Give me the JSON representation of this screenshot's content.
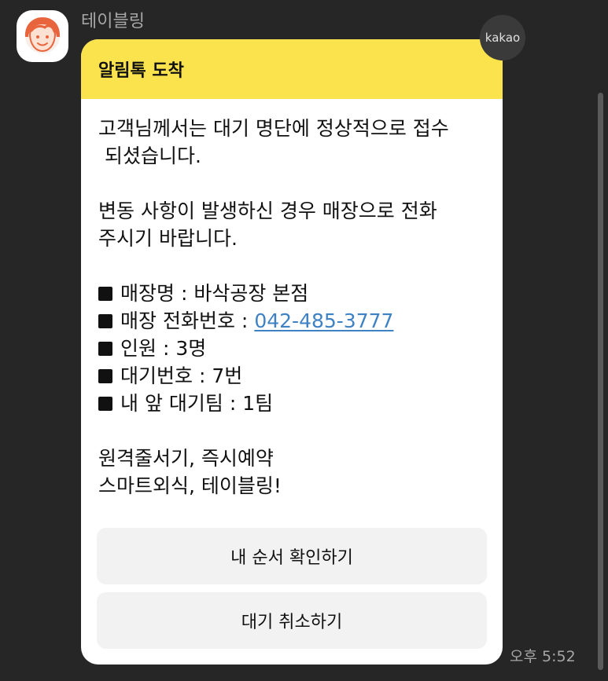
{
  "sender": {
    "name": "테이블링"
  },
  "badge": {
    "label": "kakao"
  },
  "message": {
    "header_title": "알림톡 도착",
    "paragraph1_line1": "고객님께서는 대기 명단에 정상적으로 접수",
    "paragraph1_line2": " 되셨습니다.",
    "paragraph2_line1": "변동 사항이 발생하신 경우 매장으로 전화",
    "paragraph2_line2": "주시기 바랍니다.",
    "info": {
      "store_name": "매장명 : 바삭공장 본점",
      "phone_label": "매장 전화번호 :",
      "phone_number": "042-485-3777",
      "party_size": "인원 : 3명",
      "queue_number": "대기번호 : 7번",
      "teams_ahead": "내 앞 대기팀 : 1팀"
    },
    "slogan_line1": "원격줄서기, 즉시예약",
    "slogan_line2": "스마트외식, 테이블링!",
    "buttons": {
      "check_order": "내 순서 확인하기",
      "cancel_wait": "대기 취소하기"
    }
  },
  "timestamp": "오후 5:52",
  "icons": {
    "avatar": "person-avatar-icon",
    "bullet": "square-bullet-icon"
  },
  "colors": {
    "background": "#262626",
    "header_yellow": "#fae34c",
    "link_blue": "#3f82c4",
    "avatar_orange": "#e8643c"
  }
}
